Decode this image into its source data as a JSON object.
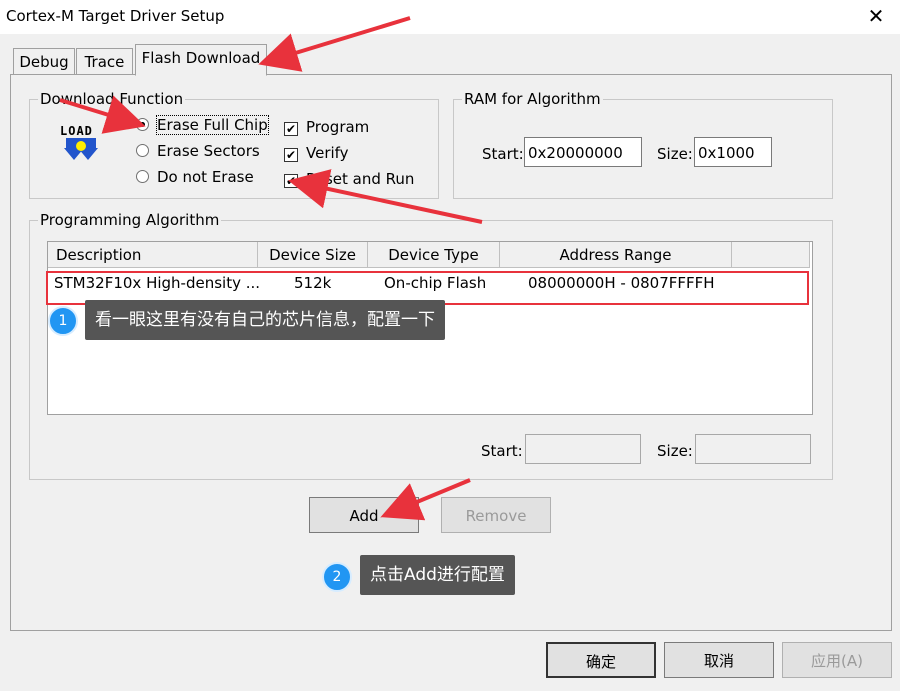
{
  "window": {
    "title": "Cortex-M Target Driver Setup",
    "close_label": "✕"
  },
  "tabs": [
    {
      "label": "Debug"
    },
    {
      "label": "Trace"
    },
    {
      "label": "Flash Download"
    }
  ],
  "download_function": {
    "group_label": "Download Function",
    "icon_text": "LOAD",
    "radios": [
      {
        "label": "Erase Full Chip",
        "selected": true
      },
      {
        "label": "Erase Sectors",
        "selected": false
      },
      {
        "label": "Do not Erase",
        "selected": false
      }
    ],
    "checks": [
      {
        "label": "Program",
        "checked": true
      },
      {
        "label": "Verify",
        "checked": true
      },
      {
        "label": "Reset and Run",
        "checked": true
      }
    ]
  },
  "ram": {
    "group_label": "RAM for Algorithm",
    "start_label": "Start:",
    "start_value": "0x20000000",
    "size_label": "Size:",
    "size_value": "0x1000"
  },
  "programming": {
    "group_label": "Programming Algorithm",
    "columns": [
      "Description",
      "Device Size",
      "Device Type",
      "Address Range"
    ],
    "rows": [
      {
        "description": "STM32F10x High-density ...",
        "size": "512k",
        "type": "On-chip Flash",
        "range": "08000000H - 0807FFFFH"
      }
    ],
    "start_label": "Start:",
    "size_label": "Size:",
    "start_value": "",
    "size_value": ""
  },
  "buttons": {
    "add": "Add",
    "remove": "Remove",
    "ok": "确定",
    "cancel": "取消",
    "apply": "应用(A)"
  },
  "annotations": {
    "tip1_badge": "1",
    "tip1_text": "看一眼这里有没有自己的芯片信息，配置一下",
    "tip2_badge": "2",
    "tip2_text": "点击Add进行配置"
  },
  "colors": {
    "annotation_red": "#e8323c",
    "badge_blue": "#2196f3",
    "tooltip_bg": "#555555"
  }
}
